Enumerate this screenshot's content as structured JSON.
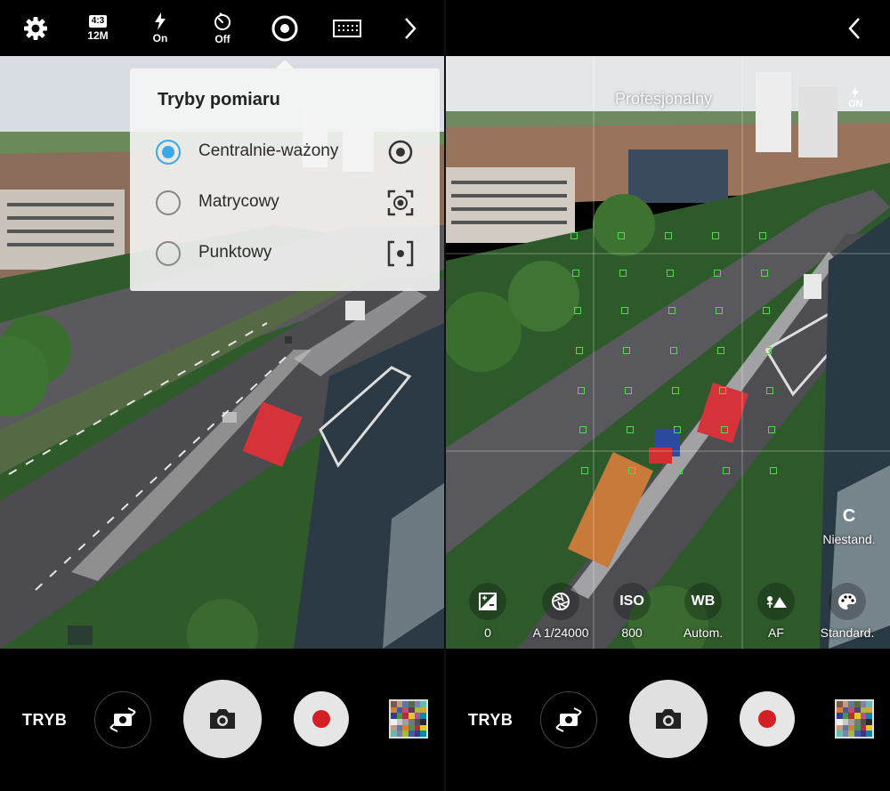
{
  "left": {
    "topbar": {
      "ratio": "4:3",
      "resolution": "12M",
      "flash": "On",
      "timer": "Off"
    },
    "popup": {
      "title": "Tryby pomiaru",
      "options": [
        {
          "label": "Centralnie-ważony",
          "selected": true,
          "icon": "center-weighted-icon"
        },
        {
          "label": "Matrycowy",
          "selected": false,
          "icon": "matrix-metering-icon"
        },
        {
          "label": "Punktowy",
          "selected": false,
          "icon": "spot-metering-icon"
        }
      ]
    },
    "bottom": {
      "mode": "TRYB"
    }
  },
  "right": {
    "overlay": {
      "mode_name": "Profesjonalny",
      "flash": "ON",
      "custom_letter": "C",
      "custom_label": "Niestand."
    },
    "params": [
      {
        "icon": "exposure-icon",
        "value": "0"
      },
      {
        "icon": "aperture-icon",
        "value": "A 1/24000"
      },
      {
        "icon_text": "ISO",
        "value": "800"
      },
      {
        "icon_text": "WB",
        "value": "Autom."
      },
      {
        "icon": "focus-mountain-icon",
        "value": "AF"
      },
      {
        "icon": "palette-icon",
        "value": "Standard."
      }
    ],
    "bottom": {
      "mode": "TRYB"
    }
  },
  "colors": {
    "accent": "#3aa7e6",
    "record": "#d32026",
    "af_point": "#4cdc4c"
  }
}
